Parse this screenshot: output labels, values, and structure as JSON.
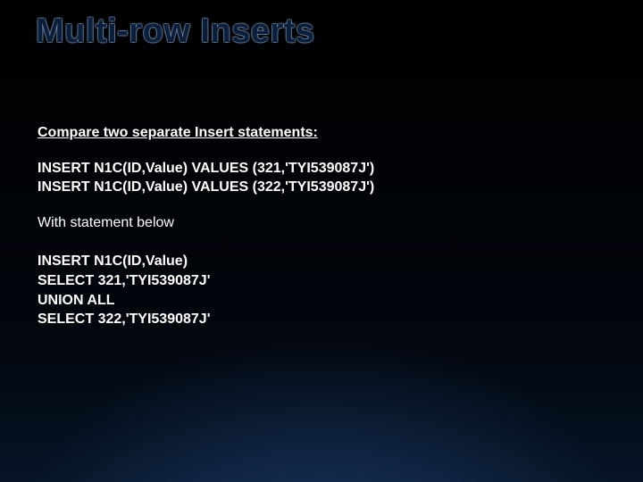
{
  "slide": {
    "title": "Multi-row Inserts",
    "compare_heading": "Compare two separate Insert statements:",
    "separate_inserts": "INSERT N1C(ID,Value) VALUES (321,'TYI539087J')\nINSERT N1C(ID,Value) VALUES (322,'TYI539087J')",
    "with_line": "With statement below",
    "union_insert": "INSERT N1C(ID,Value)\nSELECT 321,'TYI539087J'\nUNION ALL\nSELECT 322,'TYI539087J'"
  }
}
